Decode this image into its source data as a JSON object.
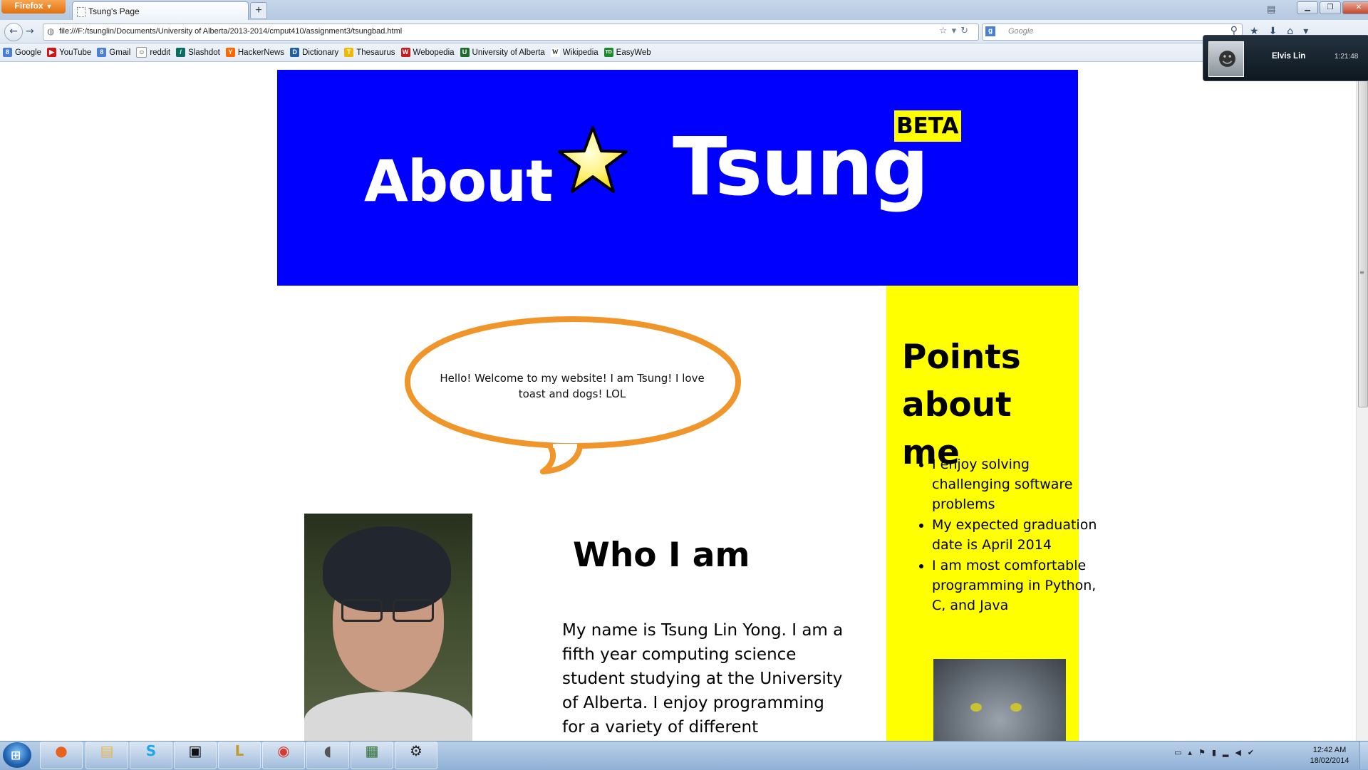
{
  "browser": {
    "menu_label": "Firefox",
    "tab_title": "Tsung's Page",
    "new_tab": "+",
    "url": "file:///F:/tsunglin/Documents/University of Alberta/2013-2014/cmput410/assignment3/tsungbad.html",
    "search_placeholder": "Google",
    "search_engine_icon": "google-icon",
    "bookmarks": [
      {
        "label": "Google",
        "icon": "google-icon",
        "color": "#4a7fd6",
        "glyph": "8"
      },
      {
        "label": "YouTube",
        "icon": "youtube-icon",
        "color": "#d01515",
        "glyph": "▶"
      },
      {
        "label": "Gmail",
        "icon": "google-icon",
        "color": "#4a7fd6",
        "glyph": "8"
      },
      {
        "label": "reddit",
        "icon": "reddit-icon",
        "color": "#ffffff",
        "glyph": "☺"
      },
      {
        "label": "Slashdot",
        "icon": "slashdot-icon",
        "color": "#0b6d61",
        "glyph": "/"
      },
      {
        "label": "HackerNews",
        "icon": "hackernews-icon",
        "color": "#ff6600",
        "glyph": "Y"
      },
      {
        "label": "Dictionary",
        "icon": "dictionary-icon",
        "color": "#1f5fa8",
        "glyph": "D"
      },
      {
        "label": "Thesaurus",
        "icon": "thesaurus-icon",
        "color": "#f0b800",
        "glyph": "T"
      },
      {
        "label": "Webopedia",
        "icon": "webopedia-icon",
        "color": "#c81b1b",
        "glyph": "W"
      },
      {
        "label": "University of Alberta",
        "icon": "ualberta-icon",
        "color": "#1c6b2c",
        "glyph": "U"
      },
      {
        "label": "Wikipedia",
        "icon": "wikipedia-icon",
        "color": "#ffffff",
        "glyph": "W"
      },
      {
        "label": "EasyWeb",
        "icon": "td-icon",
        "color": "#1a8a2a",
        "glyph": "TD"
      }
    ]
  },
  "notification": {
    "name": "Elvis Lin",
    "time": "1:21:48"
  },
  "page": {
    "banner": {
      "about": "About",
      "title": "Tsung",
      "badge": "BETA",
      "bg_color": "#0000ff"
    },
    "speech_bubble": "Hello! Welcome to my website! I am Tsung! I love toast and dogs! LOL",
    "sidebar": {
      "title": "Points about me",
      "bg_color": "#ffff00",
      "items": [
        "I enjoy solving challenging software problems",
        "My expected graduation date is April 2014",
        "I am most comfortable programming in Python, C, and Java"
      ]
    },
    "who_heading": "Who I am",
    "bio": "My name is Tsung Lin Yong. I am a fifth year computing science student studying at the University of Alberta. I enjoy programming for a variety of different"
  },
  "taskbar": {
    "apps": [
      "firefox-icon",
      "explorer-icon",
      "skype-icon",
      "terminal-icon",
      "league-of-legends-icon",
      "chrome-icon",
      "mouse-icon",
      "monitor-icon",
      "steam-icon"
    ],
    "clock_time": "12:42 AM",
    "clock_date": "18/02/2014"
  }
}
